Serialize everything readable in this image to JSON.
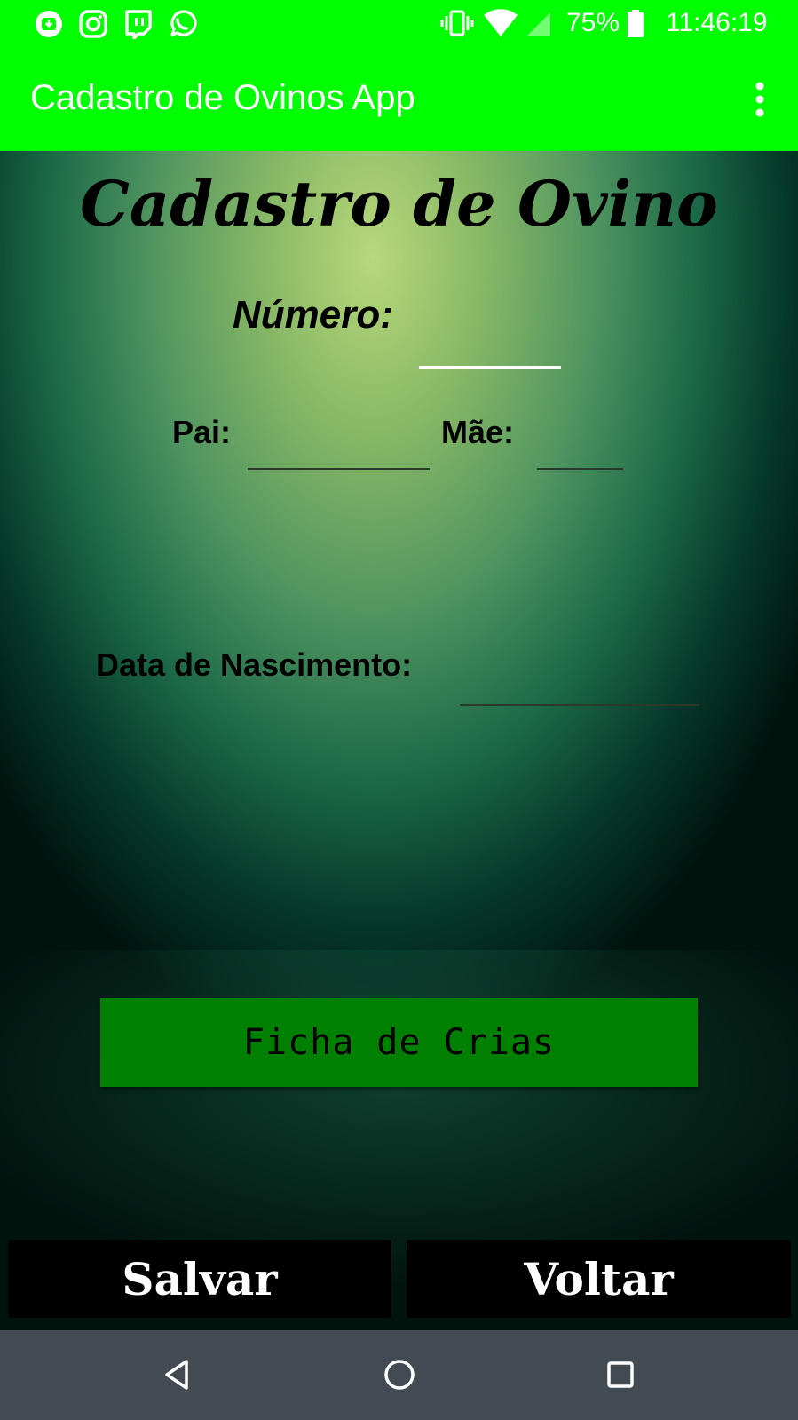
{
  "status_bar": {
    "notification_icons": [
      "download-icon",
      "instagram-icon",
      "twitch-icon",
      "whatsapp-icon"
    ],
    "battery": "75%",
    "time": "11:46:19"
  },
  "app_bar": {
    "title": "Cadastro de Ovinos App",
    "menu_icon": "more-vertical-icon"
  },
  "form": {
    "title": "Cadastro de Ovino",
    "numero_label": "Número:",
    "numero_value": "",
    "pai_label": "Pai:",
    "pai_value": "",
    "mae_label": "Mãe:",
    "mae_value": "",
    "data_nascimento_label": "Data de Nascimento:",
    "data_nascimento_value": ""
  },
  "buttons": {
    "ficha_crias": "Ficha de Crias",
    "salvar": "Salvar",
    "voltar": "Voltar"
  },
  "colors": {
    "app_bar": "#00ff00",
    "crias_button": "#008000",
    "bottom_buttons": "#000000",
    "nav_bar": "#424a52"
  },
  "nav_bar": {
    "icons": [
      "back-icon",
      "home-icon",
      "recents-icon"
    ]
  }
}
